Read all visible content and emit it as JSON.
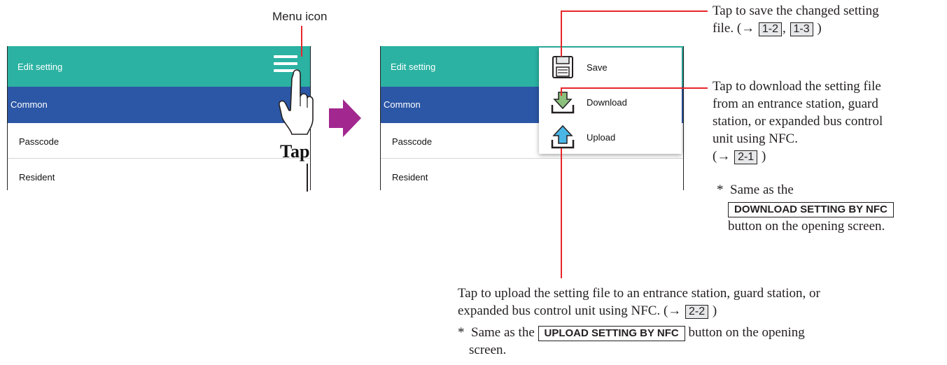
{
  "callout_menu": "Menu icon",
  "tap_label": "Tap",
  "left_screen": {
    "title": "Edit setting",
    "category": "Common",
    "items": [
      "Passcode",
      "Resident"
    ]
  },
  "right_screen": {
    "title": "Edit setting",
    "category": "Common",
    "items": [
      "Passcode",
      "Resident"
    ],
    "menu": [
      {
        "label": "Save",
        "icon": "floppy-disk-icon"
      },
      {
        "label": "Download",
        "icon": "download-arrow-icon"
      },
      {
        "label": "Upload",
        "icon": "upload-arrow-icon"
      }
    ]
  },
  "notes": {
    "save": {
      "line1": "Tap to save the changed setting",
      "line2_prefix": "file. (→",
      "ref1": "1-2",
      "sep": ",",
      "ref2": "1-3",
      "close": ")"
    },
    "download": {
      "lines": [
        "Tap to download the setting file",
        "from an entrance station, guard",
        "station, or expanded bus control",
        "unit using NFC."
      ],
      "ref_prefix": "(→",
      "ref": "2-1",
      "close": ")",
      "star": "*",
      "same_as": "Same as the",
      "button": "DOWNLOAD SETTING BY NFC",
      "tail": "button on the opening screen."
    },
    "upload": {
      "line1": "Tap to upload the setting file to an entrance station, guard station, or",
      "line2_prefix": "expanded bus control unit using NFC. (→",
      "ref": "2-2",
      "close": ")",
      "star": "*",
      "same_as": "Same as the",
      "button": "UPLOAD SETTING BY NFC",
      "tail1": "button on the opening",
      "tail2": "screen."
    }
  },
  "colors": {
    "header": "#2bb2a2",
    "category": "#2c57a6",
    "callout_line": "#e8262a",
    "arrow": "#a2278f"
  }
}
